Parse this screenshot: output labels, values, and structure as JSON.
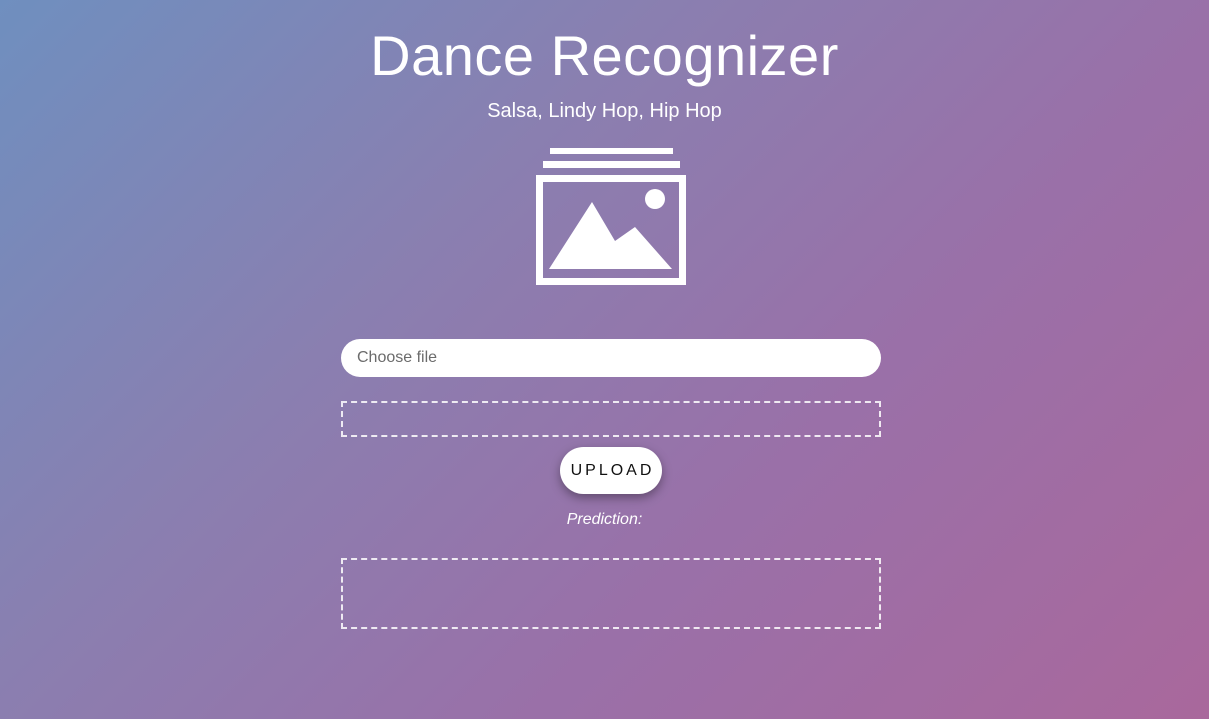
{
  "header": {
    "title": "Dance Recognizer",
    "subtitle": "Salsa, Lindy Hop, Hip Hop"
  },
  "hero": {
    "icon": "image-gallery-icon"
  },
  "upload_form": {
    "file_placeholder": "Choose file",
    "upload_label": "UPLOAD",
    "prediction_label": "Prediction:"
  },
  "colors": {
    "gradient_start": "#6f8fbf",
    "gradient_end": "#a9689c",
    "text": "#ffffff",
    "button_bg": "#ffffff"
  }
}
